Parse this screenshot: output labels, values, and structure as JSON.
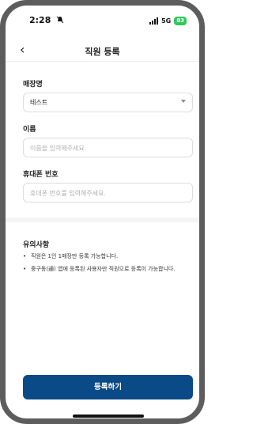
{
  "status_bar": {
    "time": "2:28",
    "network": "5G",
    "battery": "83"
  },
  "header": {
    "back_symbol": "‹",
    "title": "직원 등록"
  },
  "form": {
    "store": {
      "label": "매장명",
      "value": "테스트"
    },
    "name": {
      "label": "이름",
      "placeholder": "이름을 입력해주세요."
    },
    "phone": {
      "label": "휴대폰 번호",
      "placeholder": "휴대폰 번호를 입력해주세요."
    }
  },
  "notes": {
    "title": "유의사항",
    "items": [
      "직원은 1인 1매장만 등록 가능합니다.",
      "중구동(通) 앱에 등록된 사용자만 직원으로 등록이 가능합니다."
    ]
  },
  "submit_label": "등록하기"
}
